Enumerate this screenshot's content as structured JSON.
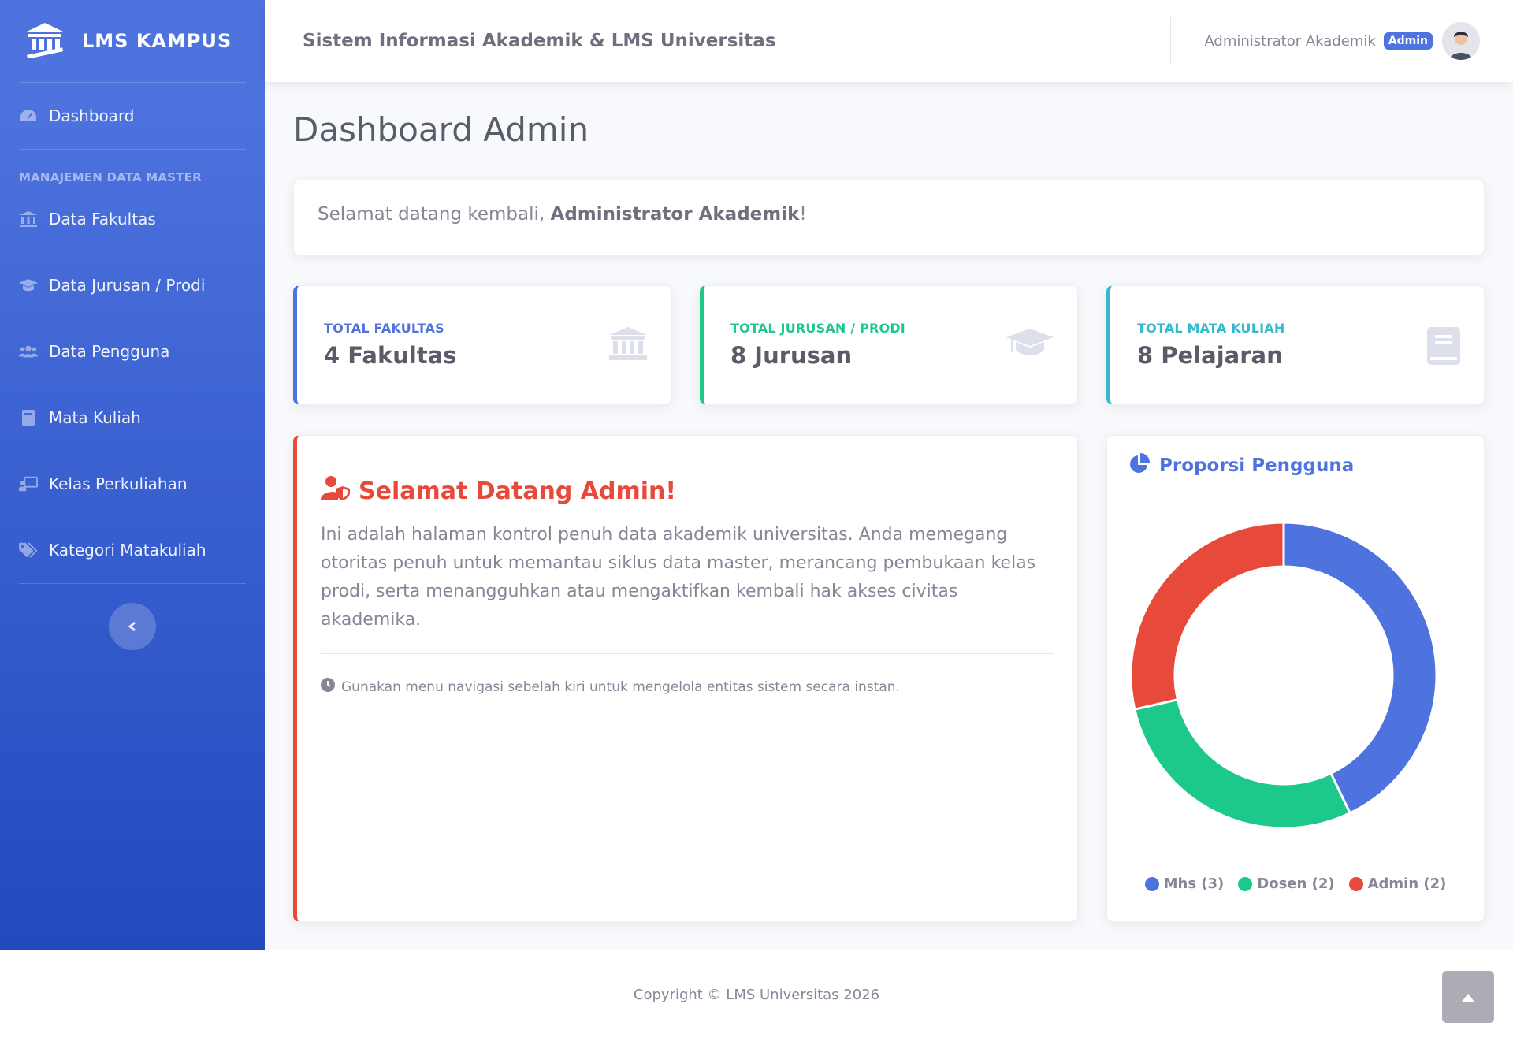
{
  "brand": {
    "name": "LMS KAMPUS",
    "icon": "university-icon"
  },
  "sidebar": {
    "dashboard": {
      "label": "Dashboard",
      "icon": "tachometer-icon"
    },
    "heading": "MANAJEMEN DATA MASTER",
    "items": [
      {
        "label": "Data Fakultas",
        "icon": "university-icon"
      },
      {
        "label": "Data Jurusan / Prodi",
        "icon": "graduation-cap-icon"
      },
      {
        "label": "Data Pengguna",
        "icon": "users-icon"
      },
      {
        "label": "Mata Kuliah",
        "icon": "book-icon"
      },
      {
        "label": "Kelas Perkuliahan",
        "icon": "chalkboard-teacher-icon"
      },
      {
        "label": "Kategori Matakuliah",
        "icon": "tags-icon"
      }
    ],
    "toggle_icon": "chevron-left-icon"
  },
  "topbar": {
    "title": "Sistem Informasi Akademik & LMS Universitas",
    "user_name": "Administrator Akademik",
    "role_badge": "Admin"
  },
  "page": {
    "title": "Dashboard Admin",
    "welcome_prefix": "Selamat datang kembali, ",
    "welcome_name": "Administrator Akademik",
    "welcome_suffix": "!"
  },
  "stats": [
    {
      "label": "TOTAL FAKULTAS",
      "value": "4 Fakultas",
      "color": "#4e73df",
      "icon": "university-icon"
    },
    {
      "label": "TOTAL JURUSAN / PRODI",
      "value": "8 Jurusan",
      "color": "#1cc88a",
      "icon": "graduation-cap-icon"
    },
    {
      "label": "TOTAL MATA KULIAH",
      "value": "8 Pelajaran",
      "color": "#36b9cc",
      "icon": "book-icon"
    }
  ],
  "info": {
    "title": "Selamat Datang Admin!",
    "text": "Ini adalah halaman kontrol penuh data akademik universitas. Anda memegang otoritas penuh untuk memantau siklus data master, merancang pembukaan kelas prodi, serta menangguhkan atau mengaktifkan kembali hak akses civitas akademika.",
    "note": "Gunakan menu navigasi sebelah kiri untuk mengelola entitas sistem secara instan."
  },
  "chart_card": {
    "title": "Proporsi Pengguna"
  },
  "chart_data": {
    "type": "pie",
    "categories": [
      "Mhs",
      "Dosen",
      "Admin"
    ],
    "values": [
      3,
      2,
      2
    ],
    "legend_labels": [
      "Mhs (3)",
      "Dosen (2)",
      "Admin (2)"
    ],
    "colors": [
      "#4e73df",
      "#1cc88a",
      "#e74a3b"
    ],
    "donut": true,
    "legend_position": "bottom"
  },
  "footer": {
    "copyright": "Copyright © LMS Universitas 2026"
  }
}
